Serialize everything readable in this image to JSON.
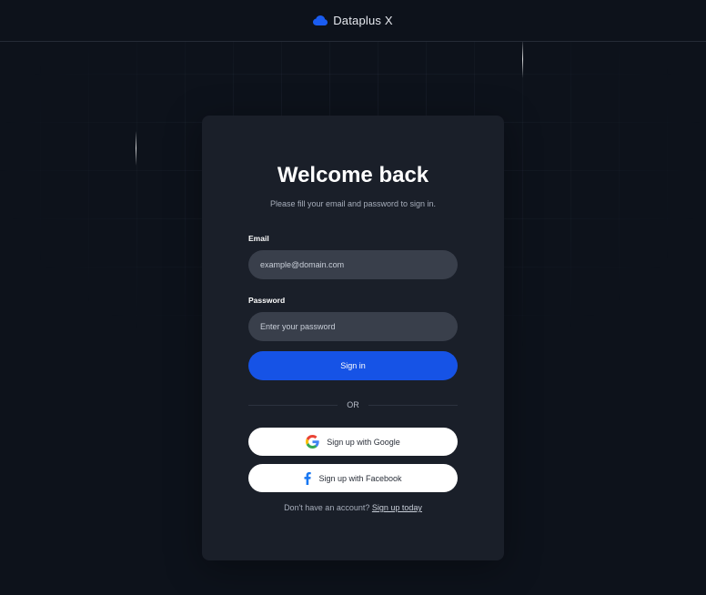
{
  "header": {
    "brand_name": "Dataplus X",
    "logo_icon": "cloud-icon"
  },
  "login": {
    "title": "Welcome back",
    "subtitle": "Please fill your email and password to sign in.",
    "email_label": "Email",
    "email_placeholder": "example@domain.com",
    "email_value": "",
    "password_label": "Password",
    "password_placeholder": "Enter your password",
    "password_value": "",
    "signin_label": "Sign in",
    "divider_text": "OR",
    "google_label": "Sign up with Google",
    "google_icon": "google-icon",
    "facebook_label": "Sign up with Facebook",
    "facebook_icon": "facebook-icon",
    "footer_text": "Don't have an account?",
    "footer_link": "Sign up today"
  },
  "colors": {
    "background": "#0d121b",
    "card": "#1a1f29",
    "input": "#393f4b",
    "primary": "#1653e6",
    "facebook": "#1877f2"
  }
}
